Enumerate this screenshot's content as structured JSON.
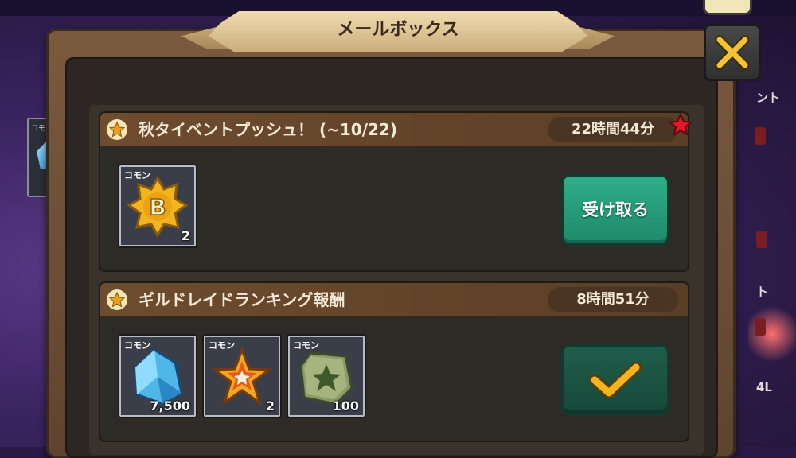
{
  "dialog": {
    "title": "メールボックス"
  },
  "mails": [
    {
      "title": "秋タイベントプッシュ！ (~10/22)",
      "time_left": "22時間44分",
      "is_new": true,
      "rewards": [
        {
          "rarity": "コモン",
          "icon": "b-badge-icon",
          "quantity": "2"
        }
      ],
      "action_label": "受け取る",
      "claimed": false
    },
    {
      "title": "ギルドレイドランキング報酬",
      "time_left": "8時間51分",
      "is_new": false,
      "rewards": [
        {
          "rarity": "コモン",
          "icon": "blue-crystal-icon",
          "quantity": "7,500"
        },
        {
          "rarity": "コモン",
          "icon": "gold-star-icon",
          "quantity": "2"
        },
        {
          "rarity": "コモン",
          "icon": "green-stone-icon",
          "quantity": "100"
        }
      ],
      "action_icon": "checkmark-icon",
      "claimed": true
    }
  ],
  "background": {
    "left_card_rarity": "コモン",
    "right_text_1": "ント",
    "right_text_2": "ト",
    "right_text_3": "4L"
  },
  "colors": {
    "claim_button": "#1e8a6a",
    "header_brown": "#6e4c2e",
    "check_gold": "#f2b51e"
  }
}
